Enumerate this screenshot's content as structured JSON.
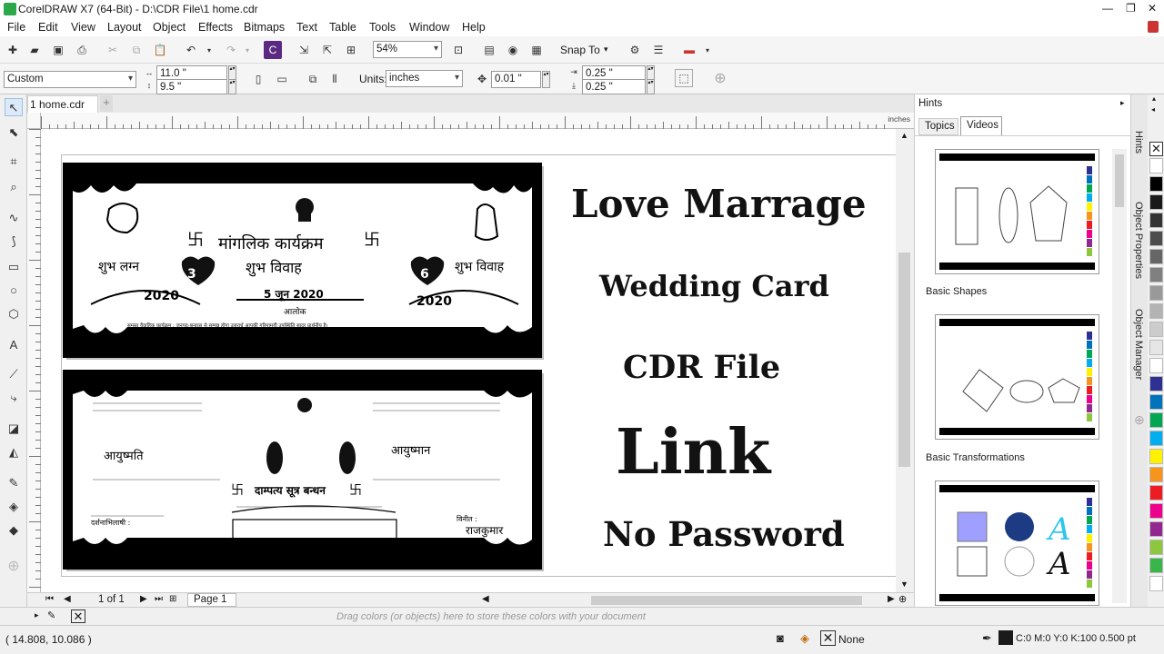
{
  "titlebar": {
    "title": "CorelDRAW X7 (64-Bit) - D:\\CDR File\\1 home.cdr",
    "min": "—",
    "max": "❐",
    "close": "✕"
  },
  "menu": [
    "File",
    "Edit",
    "View",
    "Layout",
    "Object",
    "Effects",
    "Bitmaps",
    "Text",
    "Table",
    "Tools",
    "Window",
    "Help"
  ],
  "toolbar": {
    "zoom": "54%",
    "snap_to": "Snap To"
  },
  "propertybar": {
    "page_preset": "Custom",
    "width": "11.0 \"",
    "height": "9.5 \"",
    "units_label": "Units:",
    "units": "inches",
    "nudge": "0.01 \"",
    "dup_x": "0.25 \"",
    "dup_y": "0.25 \""
  },
  "doctab": {
    "name": "1 home.cdr",
    "add": "+"
  },
  "ruler": {
    "unit": "inches"
  },
  "canvas": {
    "lines": [
      "Love Marrage",
      "Wedding Card",
      "CDR File",
      "Link",
      "No Password"
    ],
    "card_top": {
      "title": "मांगलिक कार्यक्रम",
      "subtitle": "शुभ विवाह",
      "date": "5 जून 2020",
      "left_heart": "3",
      "left_year": "2020",
      "right_heart": "6",
      "right_year": "2020",
      "left_word": "शुभ लग्न",
      "right_word": "शुभ विवाह",
      "alok": "आलोक",
      "footer": "समस्त वैवाहिक कार्यक्रम : जनपद-बनारस से सम्पन्न होगा उत्तरार्ध आपकी गरिमामयी उपस्थिति सादर प्रार्थनीय है।"
    },
    "card_bottom": {
      "groom_side": "आयुष्मति",
      "bride_side": "आयुष्मान",
      "motto": "दाम्पत्य सूत्र बन्धन",
      "sign_left": "दर्शनाभिलाषी :",
      "sign_right": "विनीत :",
      "sign_name": "राजकुमार"
    }
  },
  "pagebar": {
    "counter": "1 of 1",
    "page_tab": "Page 1"
  },
  "palettebar": {
    "hint": "Drag colors (or objects) here to store these colors with your document"
  },
  "statusbar": {
    "coords": "( 14.808, 10.086 )",
    "fill": "None",
    "outline": "C:0 M:0 Y:0 K:100  0.500 pt"
  },
  "hints": {
    "header": "Hints",
    "tabs": [
      "Topics",
      "Videos"
    ],
    "videos": [
      "Basic Shapes",
      "Basic Transformations"
    ]
  },
  "dockers": [
    "Hints",
    "Object Properties",
    "Object Manager"
  ],
  "colors": {
    "accent": "#0078d7",
    "swatches": [
      "#ffffff",
      "#000000",
      "#1a1a1a",
      "#333333",
      "#4d4d4d",
      "#666666",
      "#808080",
      "#999999",
      "#b3b3b3",
      "#cccccc",
      "#e6e6e6",
      "#ffffff",
      "#2e3192",
      "#0072bc",
      "#00a651",
      "#00aeef",
      "#fff200",
      "#f7941d",
      "#ed1c24",
      "#ec008c",
      "#92278f",
      "#8dc63f",
      "#39b54a",
      "#ffffff"
    ]
  }
}
